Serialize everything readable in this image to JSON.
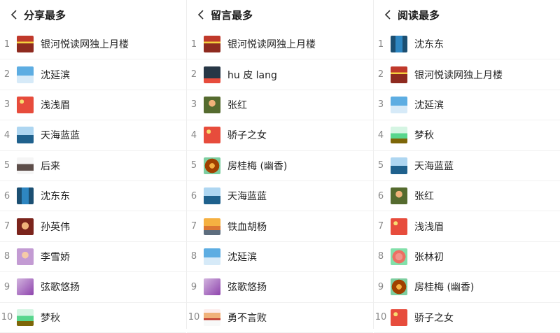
{
  "columns": [
    {
      "title": "分享最多",
      "items": [
        {
          "rank": "1",
          "name": "银河悦读网独上月楼",
          "avatar": "av-red-badge"
        },
        {
          "rank": "2",
          "name": "沈延滨",
          "avatar": "av-blue-sky"
        },
        {
          "rank": "3",
          "name": "浅浅眉",
          "avatar": "av-red-flag"
        },
        {
          "rank": "4",
          "name": "天海蓝蓝",
          "avatar": "av-sea"
        },
        {
          "rank": "5",
          "name": "后来",
          "avatar": "av-person-light"
        },
        {
          "rank": "6",
          "name": "沈东东",
          "avatar": "av-tower"
        },
        {
          "rank": "7",
          "name": "孙英伟",
          "avatar": "av-woman-dark"
        },
        {
          "rank": "8",
          "name": "李雪娇",
          "avatar": "av-pink"
        },
        {
          "rank": "9",
          "name": "弦歌悠扬",
          "avatar": "av-purple"
        },
        {
          "rank": "10",
          "name": "梦秋",
          "avatar": "av-green"
        }
      ]
    },
    {
      "title": "留言最多",
      "items": [
        {
          "rank": "1",
          "name": "银河悦读网独上月楼",
          "avatar": "av-red-badge"
        },
        {
          "rank": "2",
          "name": "hu 皮 lang",
          "avatar": "av-car"
        },
        {
          "rank": "3",
          "name": "张红",
          "avatar": "av-soldier"
        },
        {
          "rank": "4",
          "name": "骄子之女",
          "avatar": "av-red-flag"
        },
        {
          "rank": "5",
          "name": "房桂梅 (幽香)",
          "avatar": "av-flower"
        },
        {
          "rank": "6",
          "name": "天海蓝蓝",
          "avatar": "av-sea"
        },
        {
          "rank": "7",
          "name": "铁血胡杨",
          "avatar": "av-sunset"
        },
        {
          "rank": "8",
          "name": "沈延滨",
          "avatar": "av-blue-sky"
        },
        {
          "rank": "9",
          "name": "弦歌悠扬",
          "avatar": "av-purple"
        },
        {
          "rank": "10",
          "name": "勇不言败",
          "avatar": "av-man-suit"
        }
      ]
    },
    {
      "title": "阅读最多",
      "items": [
        {
          "rank": "1",
          "name": "沈东东",
          "avatar": "av-tower"
        },
        {
          "rank": "2",
          "name": "银河悦读网独上月楼",
          "avatar": "av-red-badge"
        },
        {
          "rank": "3",
          "name": "沈延滨",
          "avatar": "av-blue-sky"
        },
        {
          "rank": "4",
          "name": "梦秋",
          "avatar": "av-green"
        },
        {
          "rank": "5",
          "name": "天海蓝蓝",
          "avatar": "av-sea"
        },
        {
          "rank": "6",
          "name": "张红",
          "avatar": "av-soldier"
        },
        {
          "rank": "7",
          "name": "浅浅眉",
          "avatar": "av-red-flag"
        },
        {
          "rank": "8",
          "name": "张林初",
          "avatar": "av-pink-flower"
        },
        {
          "rank": "9",
          "name": "房桂梅 (幽香)",
          "avatar": "av-flower"
        },
        {
          "rank": "10",
          "name": "骄子之女",
          "avatar": "av-red-flag"
        }
      ]
    }
  ],
  "colors": {
    "rank_text": "#888888",
    "name_text": "#1f1f1f",
    "divider": "#f1f1f1"
  }
}
